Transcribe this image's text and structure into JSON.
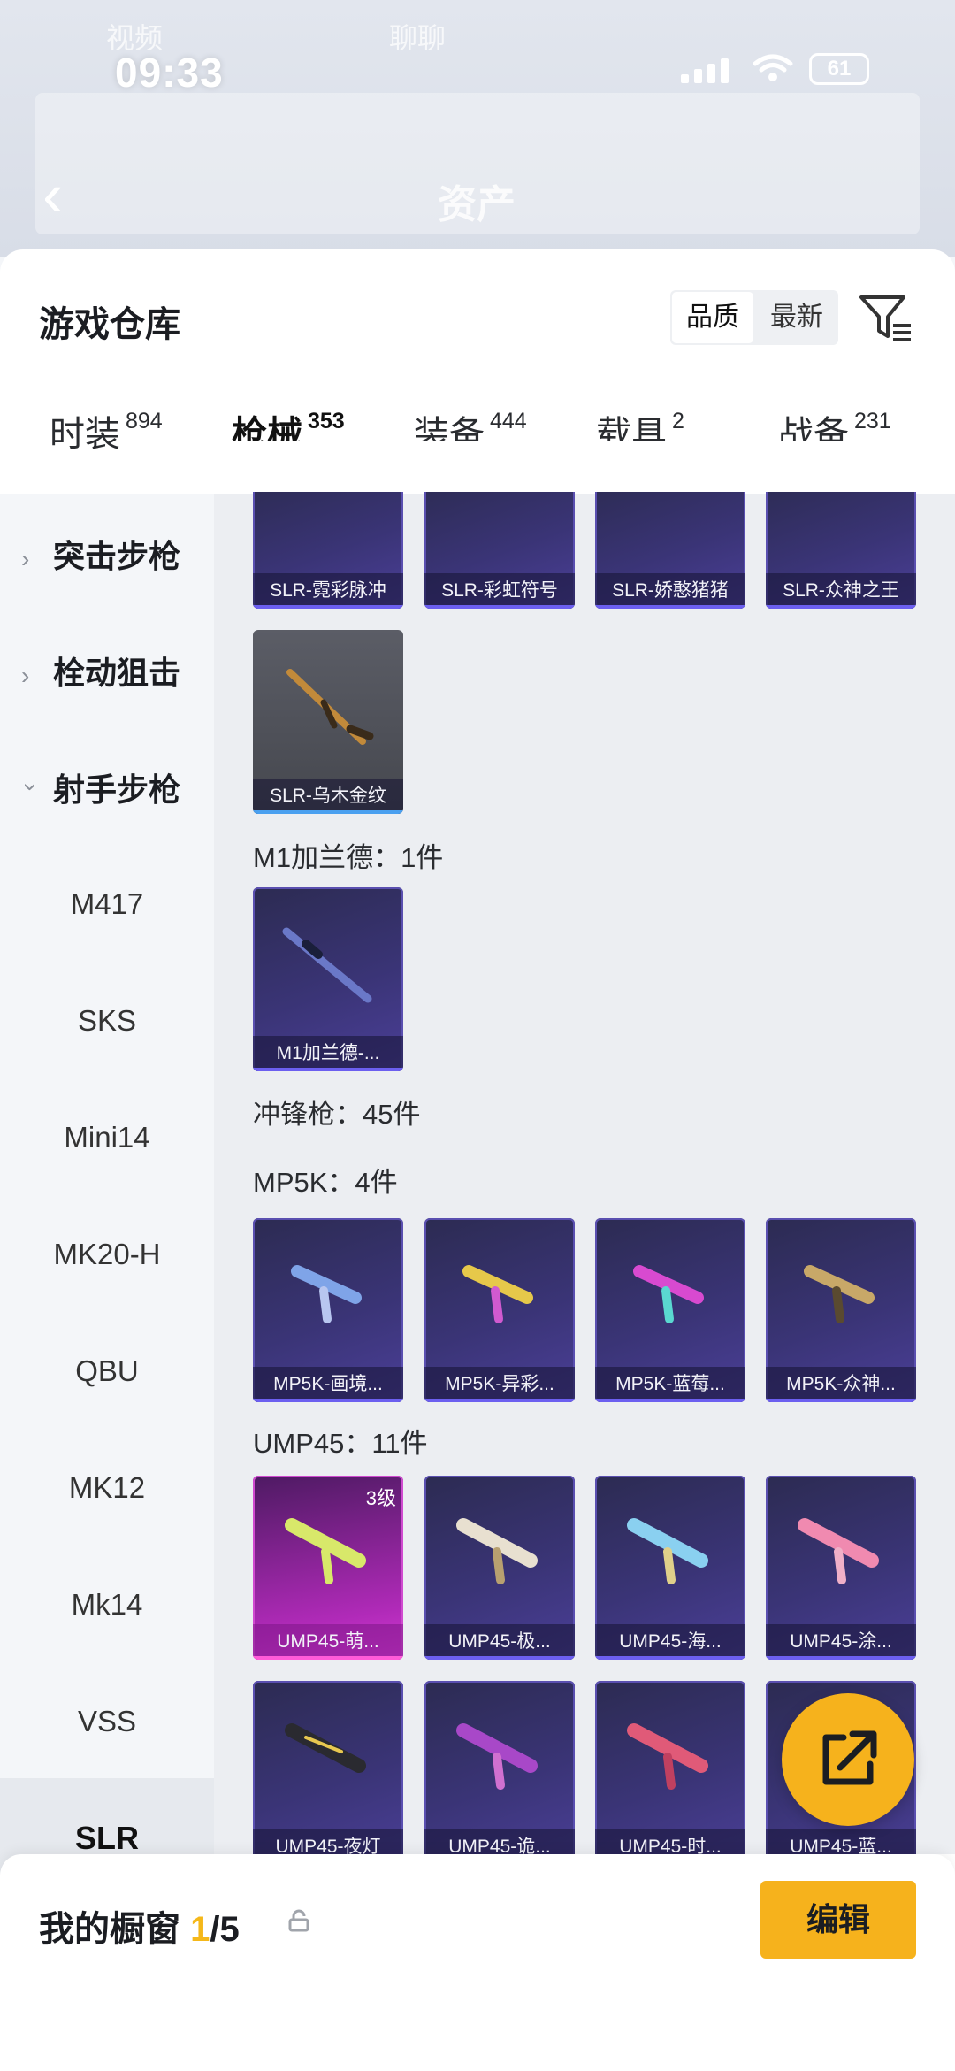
{
  "status_bar": {
    "time": "09:33",
    "battery": "61",
    "blur_left": "视频",
    "blur_right": "聊聊"
  },
  "nav": {
    "title": "资产"
  },
  "header": {
    "title": "游戏仓库",
    "sort_options": [
      "品质",
      "最新"
    ]
  },
  "tabs": [
    {
      "label": "时装",
      "count": "894"
    },
    {
      "label": "枪械",
      "count": "353"
    },
    {
      "label": "装备",
      "count": "444"
    },
    {
      "label": "载具",
      "count": "2"
    },
    {
      "label": "战备",
      "count": "231"
    }
  ],
  "sidebar": {
    "groups": [
      "突击步枪",
      "栓动狙击",
      "射手步枪"
    ],
    "items": [
      "M417",
      "SKS",
      "Mini14",
      "MK20-H",
      "QBU",
      "MK12",
      "Mk14",
      "VSS",
      "SLR"
    ]
  },
  "content": {
    "row1": [
      "SLR-霓彩脉冲",
      "SLR-彩虹符号",
      "SLR-娇憨猪猪",
      "SLR-众神之王"
    ],
    "row2": [
      "SLR-乌木金纹"
    ],
    "section_m1": "M1加兰德：1件",
    "m1_items": [
      "M1加兰德-..."
    ],
    "section_smg": "冲锋枪：45件",
    "section_mp5k": "MP5K：4件",
    "mp5k_items": [
      "MP5K-画境...",
      "MP5K-异彩...",
      "MP5K-蓝莓...",
      "MP5K-众神..."
    ],
    "section_ump": "UMP45：11件",
    "ump_row1": [
      "UMP45-萌...",
      "UMP45-极...",
      "UMP45-海...",
      "UMP45-涂..."
    ],
    "ump_level": "3级",
    "ump_row2": [
      "UMP45-夜灯",
      "UMP45-诡...",
      "UMP45-时...",
      "UMP45-蓝..."
    ]
  },
  "bottom": {
    "label": "我的橱窗",
    "current": "1",
    "total": "/5",
    "edit_label": "编辑"
  },
  "colors": {
    "accent": "#f6b21c",
    "card_purple": "#3a3476",
    "card_pink": "#b02ab8"
  }
}
